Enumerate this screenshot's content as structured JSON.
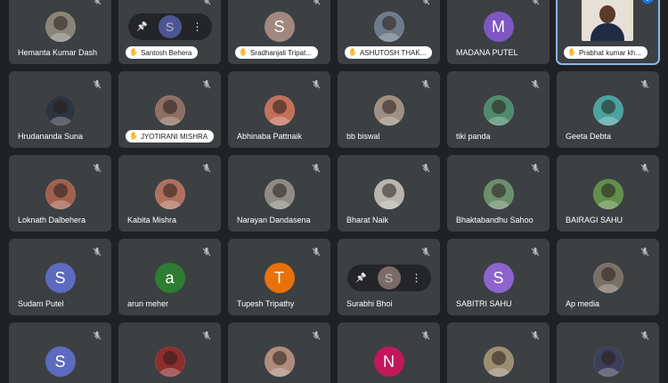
{
  "colors": {
    "tile_bg": "#3c4043",
    "page_bg": "#202124",
    "active_outline": "#8ab4f8"
  },
  "participants": [
    {
      "name": "Hemanta Kumar Dash",
      "avatar": {
        "kind": "photo",
        "color": "#8a8478"
      },
      "mic_muted": true
    },
    {
      "name": "Santosh Behera",
      "avatar": {
        "kind": "hover",
        "letter": "S",
        "color": "#5c6bc0"
      },
      "mic_muted": true,
      "pill": true
    },
    {
      "name": "Sradhanjali Tripat...",
      "avatar": {
        "kind": "letter",
        "letter": "S",
        "color": "#a1887f"
      },
      "mic_muted": true,
      "pill": true
    },
    {
      "name": "ASHUTOSH THAK...",
      "avatar": {
        "kind": "photo",
        "color": "#6d7a8a"
      },
      "mic_muted": true,
      "pill": true
    },
    {
      "name": "MADANA PUTEL",
      "avatar": {
        "kind": "letter",
        "letter": "M",
        "color": "#7e57c2"
      },
      "mic_muted": true
    },
    {
      "name": "Prabhat kumar kh...",
      "avatar": {
        "kind": "video"
      },
      "mic_muted": false,
      "pill": true,
      "active": true
    },
    {
      "name": "Hrudananda Suna",
      "avatar": {
        "kind": "photo",
        "color": "#2d3440"
      },
      "mic_muted": true
    },
    {
      "name": "JYOTIRANI MISHRA",
      "avatar": {
        "kind": "photo",
        "color": "#8d6e63"
      },
      "mic_muted": true,
      "pill": true
    },
    {
      "name": "Abhinaba Pattnaik",
      "avatar": {
        "kind": "photo",
        "color": "#c2705a"
      },
      "mic_muted": true
    },
    {
      "name": "bb biswal",
      "avatar": {
        "kind": "photo",
        "color": "#9e8f80"
      },
      "mic_muted": true
    },
    {
      "name": "tiki panda",
      "avatar": {
        "kind": "photo",
        "color": "#4e8a6e"
      },
      "mic_muted": true
    },
    {
      "name": "Geeta Debta",
      "avatar": {
        "kind": "photo",
        "color": "#4aa3a0"
      },
      "mic_muted": true
    },
    {
      "name": "Loknath Dalbehera",
      "avatar": {
        "kind": "photo",
        "color": "#a0604d"
      },
      "mic_muted": true
    },
    {
      "name": "Kabita Mishra",
      "avatar": {
        "kind": "photo",
        "color": "#b0705e"
      },
      "mic_muted": true
    },
    {
      "name": "Narayan Dandasena",
      "avatar": {
        "kind": "photo",
        "color": "#8f8a84"
      },
      "mic_muted": true
    },
    {
      "name": "Bharat Naik",
      "avatar": {
        "kind": "photo",
        "color": "#b9b4ad"
      },
      "mic_muted": true
    },
    {
      "name": "Bhaktabandhu Sahoo",
      "avatar": {
        "kind": "photo",
        "color": "#6b8e6b"
      },
      "mic_muted": true
    },
    {
      "name": "BAIRAGI SAHU",
      "avatar": {
        "kind": "photo",
        "color": "#5f8f4a"
      },
      "mic_muted": true
    },
    {
      "name": "Sudam Putel",
      "avatar": {
        "kind": "letter",
        "letter": "S",
        "color": "#5c6bc0"
      },
      "mic_muted": true
    },
    {
      "name": "arun meher",
      "avatar": {
        "kind": "letter",
        "letter": "a",
        "color": "#2e7d32"
      },
      "mic_muted": true
    },
    {
      "name": "Tupesh Tripathy",
      "avatar": {
        "kind": "letter",
        "letter": "T",
        "color": "#e8710a"
      },
      "mic_muted": true
    },
    {
      "name": "Surabhi Bhoi",
      "avatar": {
        "kind": "hover",
        "letter": "S",
        "color": "#a1887f"
      },
      "mic_muted": true
    },
    {
      "name": "SABITRI SAHU",
      "avatar": {
        "kind": "letter",
        "letter": "S",
        "color": "#8e63ce"
      },
      "mic_muted": true
    },
    {
      "name": "Ap media",
      "avatar": {
        "kind": "photo",
        "color": "#7a6f66"
      },
      "mic_muted": true
    },
    {
      "name": "",
      "avatar": {
        "kind": "letter",
        "letter": "S",
        "color": "#5c6bc0"
      },
      "mic_muted": true
    },
    {
      "name": "",
      "avatar": {
        "kind": "photo",
        "color": "#8e2d2d"
      },
      "mic_muted": true
    },
    {
      "name": "",
      "avatar": {
        "kind": "photo",
        "color": "#b08a7a"
      },
      "mic_muted": true
    },
    {
      "name": "",
      "avatar": {
        "kind": "letter",
        "letter": "N",
        "color": "#c2185b"
      },
      "mic_muted": true
    },
    {
      "name": "",
      "avatar": {
        "kind": "photo",
        "color": "#9a8d70"
      },
      "mic_muted": true
    },
    {
      "name": "",
      "avatar": {
        "kind": "photo",
        "color": "#3c3f5a"
      },
      "mic_muted": true
    }
  ],
  "icons": {
    "mic": "mic-off-icon",
    "pin": "pin-icon",
    "more": "more-vert-icon",
    "hand": "raised-hand-icon",
    "speaking": "speaking-indicator-icon"
  }
}
